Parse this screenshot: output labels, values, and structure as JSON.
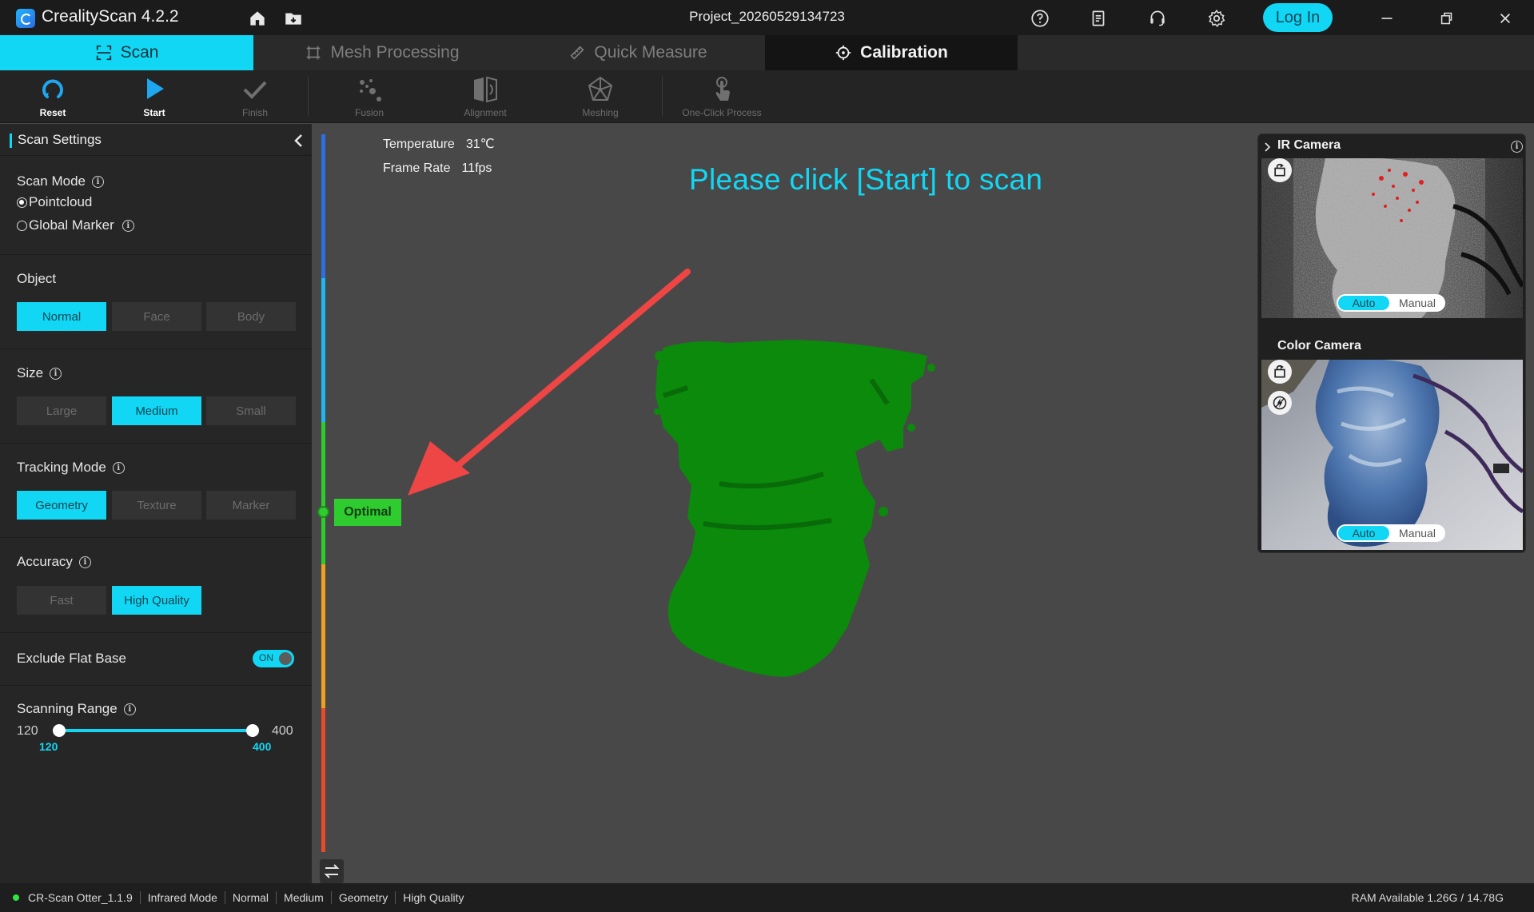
{
  "app": {
    "title": "CrealityScan 4.2.2",
    "project": "Project_20260529134723",
    "login_label": "Log In"
  },
  "tabs": [
    {
      "label": "Scan"
    },
    {
      "label": "Mesh Processing"
    },
    {
      "label": "Quick Measure"
    },
    {
      "label": "Calibration"
    }
  ],
  "toolbar": {
    "reset": "Reset",
    "start": "Start",
    "finish": "Finish",
    "fusion": "Fusion",
    "alignment": "Alignment",
    "meshing": "Meshing",
    "one_click": "One-Click Process"
  },
  "sidebar": {
    "title": "Scan Settings",
    "scan_mode": {
      "label": "Scan Mode",
      "options": [
        "Pointcloud",
        "Global Marker"
      ],
      "selected": "Pointcloud"
    },
    "object": {
      "label": "Object",
      "options": [
        "Normal",
        "Face",
        "Body"
      ],
      "selected": "Normal"
    },
    "size": {
      "label": "Size",
      "options": [
        "Large",
        "Medium",
        "Small"
      ],
      "selected": "Medium"
    },
    "tracking": {
      "label": "Tracking Mode",
      "options": [
        "Geometry",
        "Texture",
        "Marker"
      ],
      "selected": "Geometry"
    },
    "accuracy": {
      "label": "Accuracy",
      "options": [
        "Fast",
        "High Quality"
      ],
      "selected": "High Quality"
    },
    "exclude_flat_base": {
      "label": "Exclude Flat Base",
      "state": "ON"
    },
    "scanning_range": {
      "label": "Scanning Range",
      "min": "120",
      "max": "400",
      "low_value": "120",
      "high_value": "400"
    }
  },
  "viewport": {
    "temperature_label": "Temperature",
    "temperature_value": "31℃",
    "frame_rate_label": "Frame Rate",
    "frame_rate_value": "11fps",
    "hint": "Please click [Start] to scan",
    "distance_indicator": "Optimal"
  },
  "cameras": {
    "ir_title": "IR Camera",
    "color_title": "Color Camera",
    "auto_label": "Auto",
    "manual_label": "Manual"
  },
  "status": {
    "device": "CR-Scan Otter_1.1.9",
    "items": [
      "Infrared Mode",
      "Normal",
      "Medium",
      "Geometry",
      "High Quality"
    ],
    "ram": "RAM Available 1.26G / 14.78G"
  },
  "colors": {
    "accent": "#12d7f4",
    "optimal": "#2ecc2e",
    "pointcloud": "#0b8a0b",
    "arrow": "#ee4545"
  }
}
